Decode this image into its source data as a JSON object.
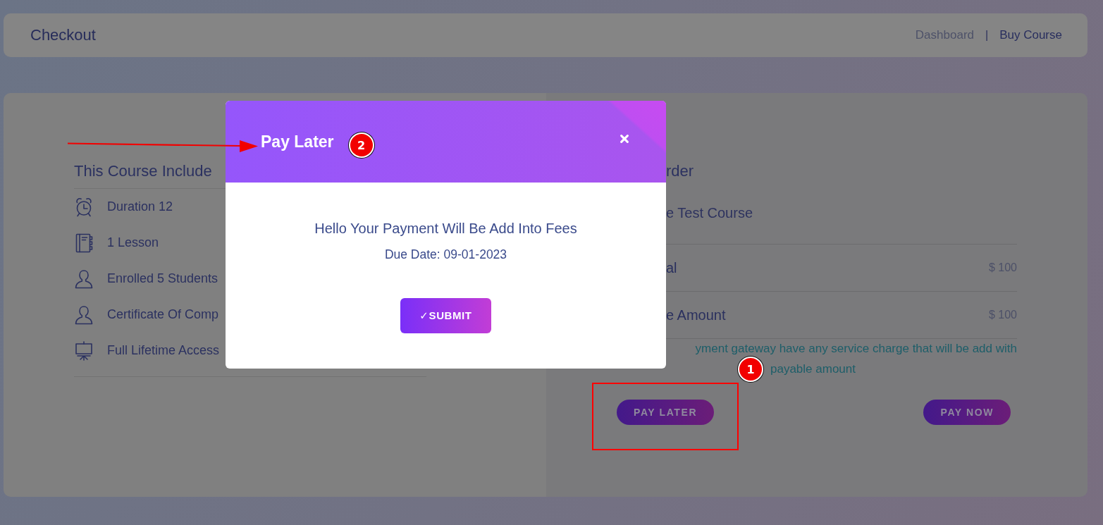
{
  "header": {
    "title": "Checkout",
    "separator": "|",
    "breadcrumb": [
      {
        "label": "Dashboard",
        "current": false
      },
      {
        "label": "Buy Course",
        "current": true
      }
    ]
  },
  "course_includes": {
    "title": "This Course Include",
    "items": [
      {
        "kind": "alarm",
        "label": "Duration 12"
      },
      {
        "kind": "notebook",
        "label": "1 Lesson"
      },
      {
        "kind": "person",
        "label": "Enrolled 5 Students"
      },
      {
        "kind": "person",
        "label": "Certificate Of Comp"
      },
      {
        "kind": "easel",
        "label": "Full Lifetime Access"
      }
    ]
  },
  "order": {
    "title": "rder",
    "course": "e Test Course",
    "rows": [
      {
        "label": "al",
        "amount": "$ 100"
      },
      {
        "label": "e Amount",
        "amount": "$ 100"
      }
    ],
    "note_lines": [
      "yment gateway have any service charge that will be add with",
      "payable amount"
    ],
    "note_badge": "1",
    "buttons": [
      {
        "label": "PAY LATER",
        "highlighted": true
      },
      {
        "label": "PAY NOW",
        "highlighted": false
      }
    ]
  },
  "modal": {
    "title": "Pay Later",
    "title_badge": "2",
    "title_arrow": true,
    "message": "Hello Your Payment Will Be Add Into Fees",
    "due_date": "Due Date: 09-01-2023",
    "submit": "✓SUBMIT"
  }
}
